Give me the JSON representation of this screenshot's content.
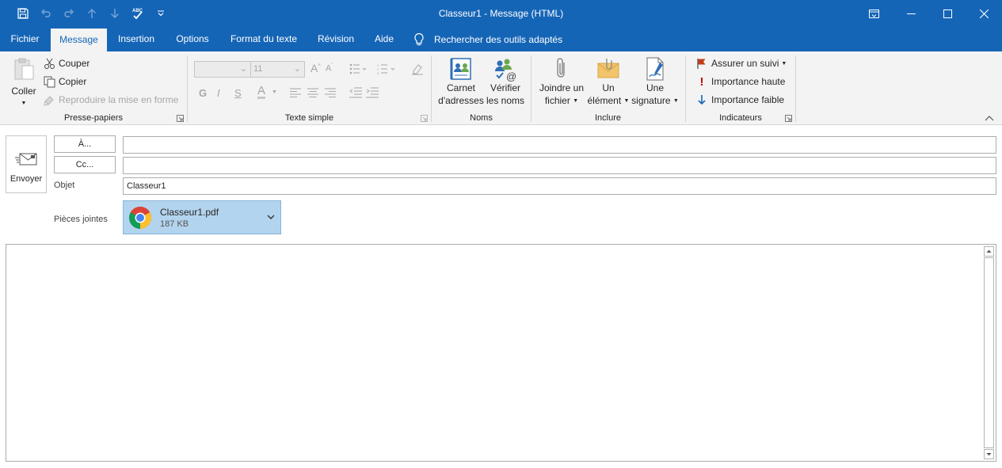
{
  "window": {
    "title": "Classeur1  -  Message (HTML)"
  },
  "tabs": [
    {
      "label": "Fichier"
    },
    {
      "label": "Message"
    },
    {
      "label": "Insertion"
    },
    {
      "label": "Options"
    },
    {
      "label": "Format du texte"
    },
    {
      "label": "Révision"
    },
    {
      "label": "Aide"
    }
  ],
  "tell_me": {
    "label": "Rechercher des outils adaptés",
    "icon": "lightbulb-icon"
  },
  "ribbon": {
    "clipboard": {
      "label": "Presse-papiers",
      "paste": "Coller",
      "cut": "Couper",
      "copy": "Copier",
      "format_painter": "Reproduire la mise en forme"
    },
    "basic_text": {
      "label": "Texte simple",
      "font_size": "11",
      "bold": "G",
      "italic": "I",
      "underline": "S",
      "font_color": "A"
    },
    "names": {
      "label": "Noms",
      "address_book_1": "Carnet",
      "address_book_2": "d'adresses",
      "check_names_1": "Vérifier",
      "check_names_2": "les noms"
    },
    "include": {
      "label": "Inclure",
      "attach_file_1": "Joindre un",
      "attach_file_2": "fichier",
      "attach_item_1": "Un",
      "attach_item_2": "élément",
      "signature_1": "Une",
      "signature_2": "signature"
    },
    "tags": {
      "label": "Indicateurs",
      "follow_up": "Assurer un suivi",
      "high_importance": "Importance haute",
      "low_importance": "Importance faible"
    }
  },
  "compose": {
    "send": "Envoyer",
    "to_button": "À...",
    "cc_button": "Cc...",
    "to_value": "",
    "cc_value": "",
    "subject_label": "Objet",
    "subject_value": "Classeur1",
    "attachments_label": "Pièces jointes",
    "attachment": {
      "name": "Classeur1.pdf",
      "size": "187 KB",
      "icon": "chrome-icon"
    }
  },
  "colors": {
    "accent": "#1565b7",
    "ribbon_bg": "#f3f3f3",
    "attachment_bg": "#b3d4ee",
    "flag": "#c43e1c",
    "importance_high": "#c00000",
    "importance_low": "#1565b7"
  }
}
